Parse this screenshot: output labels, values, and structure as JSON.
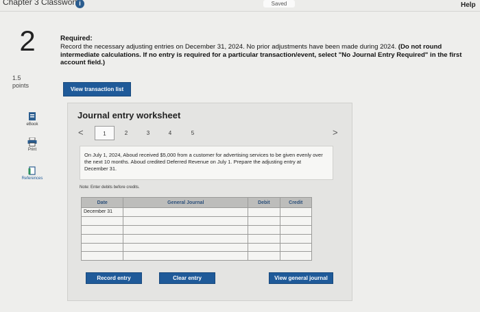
{
  "header": {
    "chapter_title": "Chapter 3 Classwork",
    "info_badge": "i",
    "saved_label": "Saved",
    "help_label": "Help"
  },
  "question": {
    "number": "2",
    "points_value": "1.5",
    "points_label": "points",
    "required_title": "Required:",
    "required_text": "Record the necessary adjusting entries on December 31, 2024. No prior adjustments have been made during 2024.",
    "required_bold": "(Do not round intermediate calculations. If no entry is required for a particular transaction/event, select \"No Journal Entry Required\" in the first account field.)",
    "view_transaction_list_label": "View transaction list"
  },
  "sidebar": {
    "ebook_label": "eBook",
    "print_label": "Print",
    "references_label": "References"
  },
  "worksheet": {
    "title": "Journal entry worksheet",
    "prev_arrow": "<",
    "next_arrow": ">",
    "pages": [
      "1",
      "2",
      "3",
      "4",
      "5"
    ],
    "active_page": "1",
    "transaction_text": "On July 1, 2024, Aboud received $5,000 from a customer for advertising services to be given evenly over the next 10 months. Aboud credited Deferred Revenue on July 1. Prepare the adjusting entry at December 31.",
    "note": "Note: Enter debits before credits.",
    "columns": {
      "date": "Date",
      "general_journal": "General Journal",
      "debit": "Debit",
      "credit": "Credit"
    },
    "rows": [
      {
        "date": "December 31"
      },
      {
        "date": ""
      },
      {
        "date": ""
      },
      {
        "date": ""
      },
      {
        "date": ""
      },
      {
        "date": ""
      }
    ],
    "record_entry_label": "Record entry",
    "clear_entry_label": "Clear entry",
    "view_general_journal_label": "View general journal"
  },
  "colors": {
    "button_blue": "#1f5a99",
    "header_text_blue": "#2b4f7a"
  }
}
